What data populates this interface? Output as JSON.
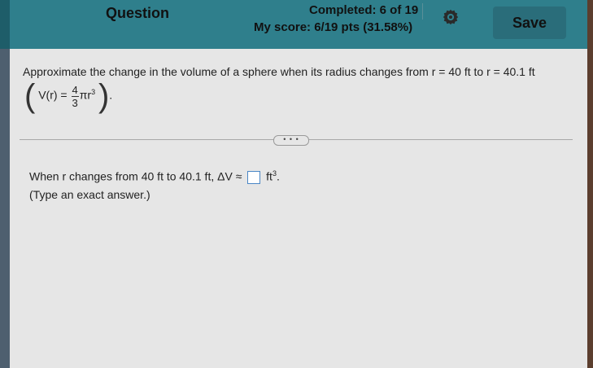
{
  "header": {
    "question_label": "Question",
    "completed_text": "Completed: 6 of 19",
    "score_text": "My score: 6/19 pts (31.58%)",
    "save_label": "Save"
  },
  "problem": {
    "prompt_before": "Approximate the change in the volume of a sphere when its radius changes from ",
    "r_from": "r = 40",
    "unit1": "ft",
    "to_word": "to",
    "r_to": "r = 40.1",
    "unit2": "ft",
    "formula_lhs": "V(r) =",
    "frac_num": "4",
    "frac_den": "3",
    "formula_rhs": "πr",
    "formula_exp": "3",
    "formula_end": "."
  },
  "more_button_label": "• • •",
  "answer": {
    "lead_text": "When r changes from 40 ft to 40.1 ft, ΔV ≈",
    "unit": "ft",
    "unit_exp": "3",
    "end": ".",
    "hint": "(Type an exact answer.)"
  },
  "colors": {
    "header_bg": "#2f7f8c",
    "panel_bg": "#e6e6e6",
    "answer_box_border": "#4a86c5"
  }
}
